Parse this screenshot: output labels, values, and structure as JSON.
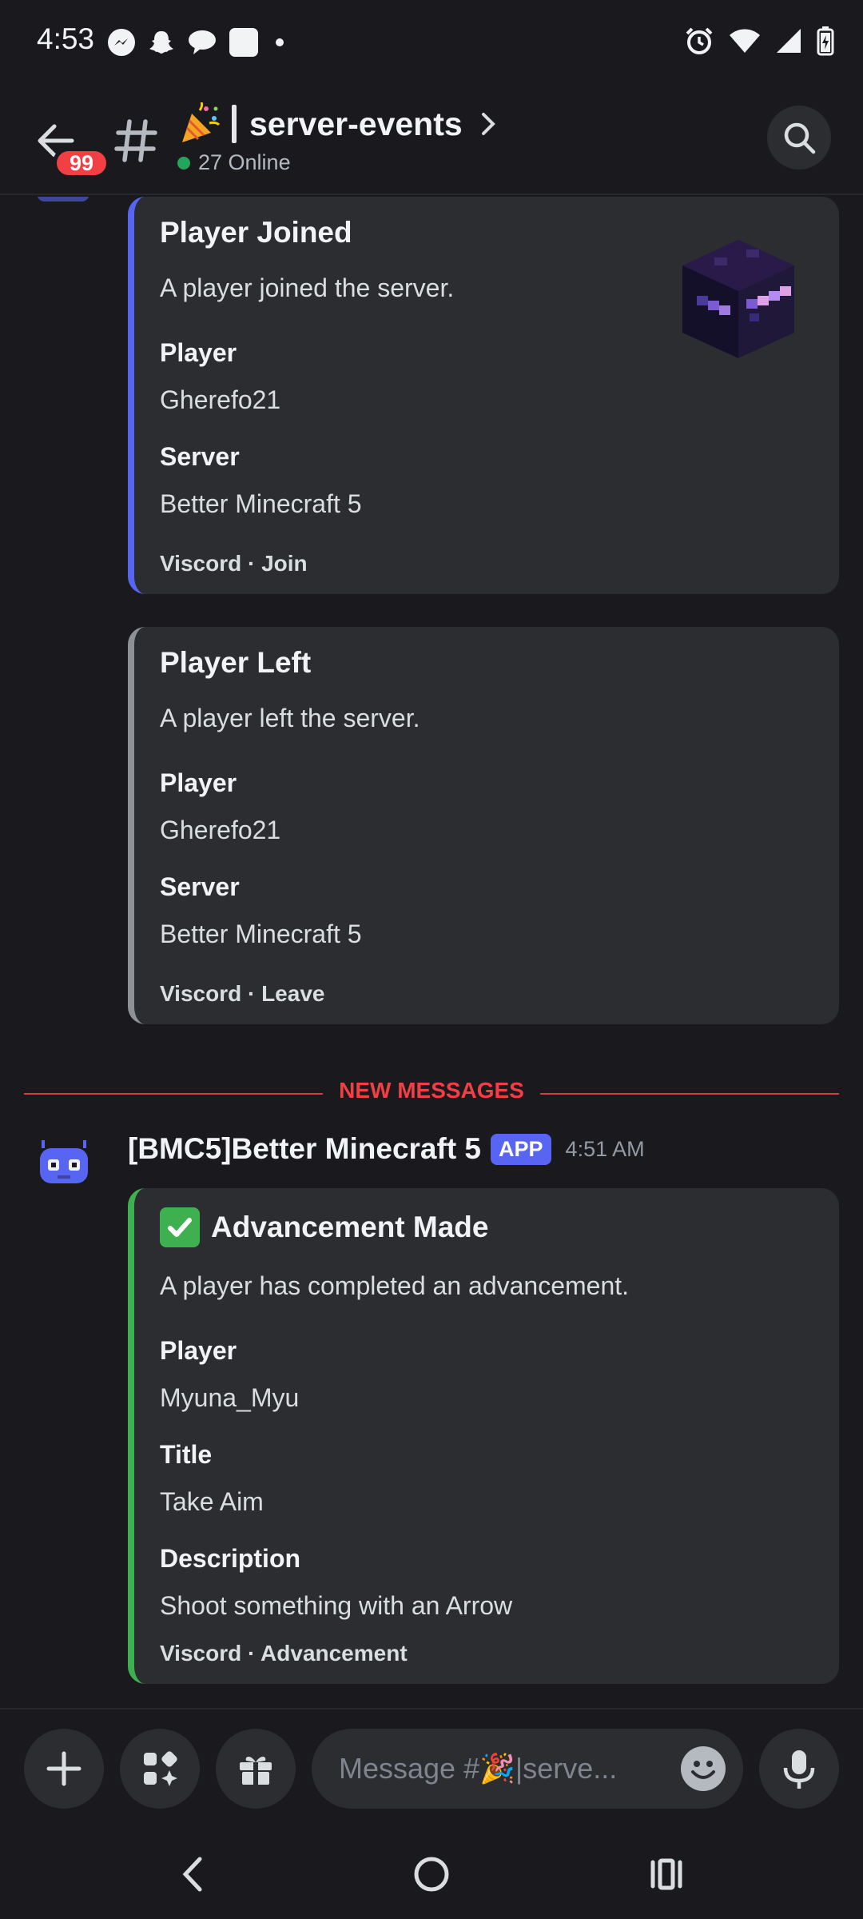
{
  "status_bar": {
    "time": "4:53",
    "left_icons": [
      "messenger-icon",
      "snapchat-icon",
      "chat-bubble-icon",
      "square-app-icon",
      "dot-icon"
    ],
    "right_icons": [
      "alarm-icon",
      "wifi-icon",
      "signal-icon",
      "battery-charging-icon"
    ]
  },
  "header": {
    "unread_count": "99",
    "channel_emoji": "party-popper-icon",
    "channel_name": "server-events",
    "online_text": "27 Online",
    "online_color": "#23a55a"
  },
  "embeds": [
    {
      "title": "Player Joined",
      "description": "A player joined the server.",
      "accent": "#5865f2",
      "fields": [
        {
          "name": "Player",
          "value": "Gherefo21"
        },
        {
          "name": "Server",
          "value": "Better Minecraft 5"
        }
      ],
      "footer": "Viscord · Join",
      "thumbnail": "minecraft-player-head-icon"
    },
    {
      "title": "Player Left",
      "description": "A player left the server.",
      "accent": "#8e9297",
      "fields": [
        {
          "name": "Player",
          "value": "Gherefo21"
        },
        {
          "name": "Server",
          "value": "Better Minecraft 5"
        }
      ],
      "footer": "Viscord · Leave"
    }
  ],
  "divider": {
    "label": "NEW MESSAGES",
    "color": "#f23f43"
  },
  "message": {
    "author": "[BMC5]Better Minecraft 5",
    "badge": "APP",
    "time": "4:51 AM",
    "embed": {
      "title": "Advancement Made",
      "title_icon": "check-mark-icon",
      "description": "A player has completed an advancement.",
      "accent": "#3fb04f",
      "fields": [
        {
          "name": "Player",
          "value": "Myuna_Myu"
        },
        {
          "name": "Title",
          "value": "Take Aim"
        },
        {
          "name": "Description",
          "value": "Shoot something with an Arrow"
        }
      ],
      "footer": "Viscord · Advancement"
    }
  },
  "composer": {
    "placeholder": "Message #🎉|serve..."
  }
}
